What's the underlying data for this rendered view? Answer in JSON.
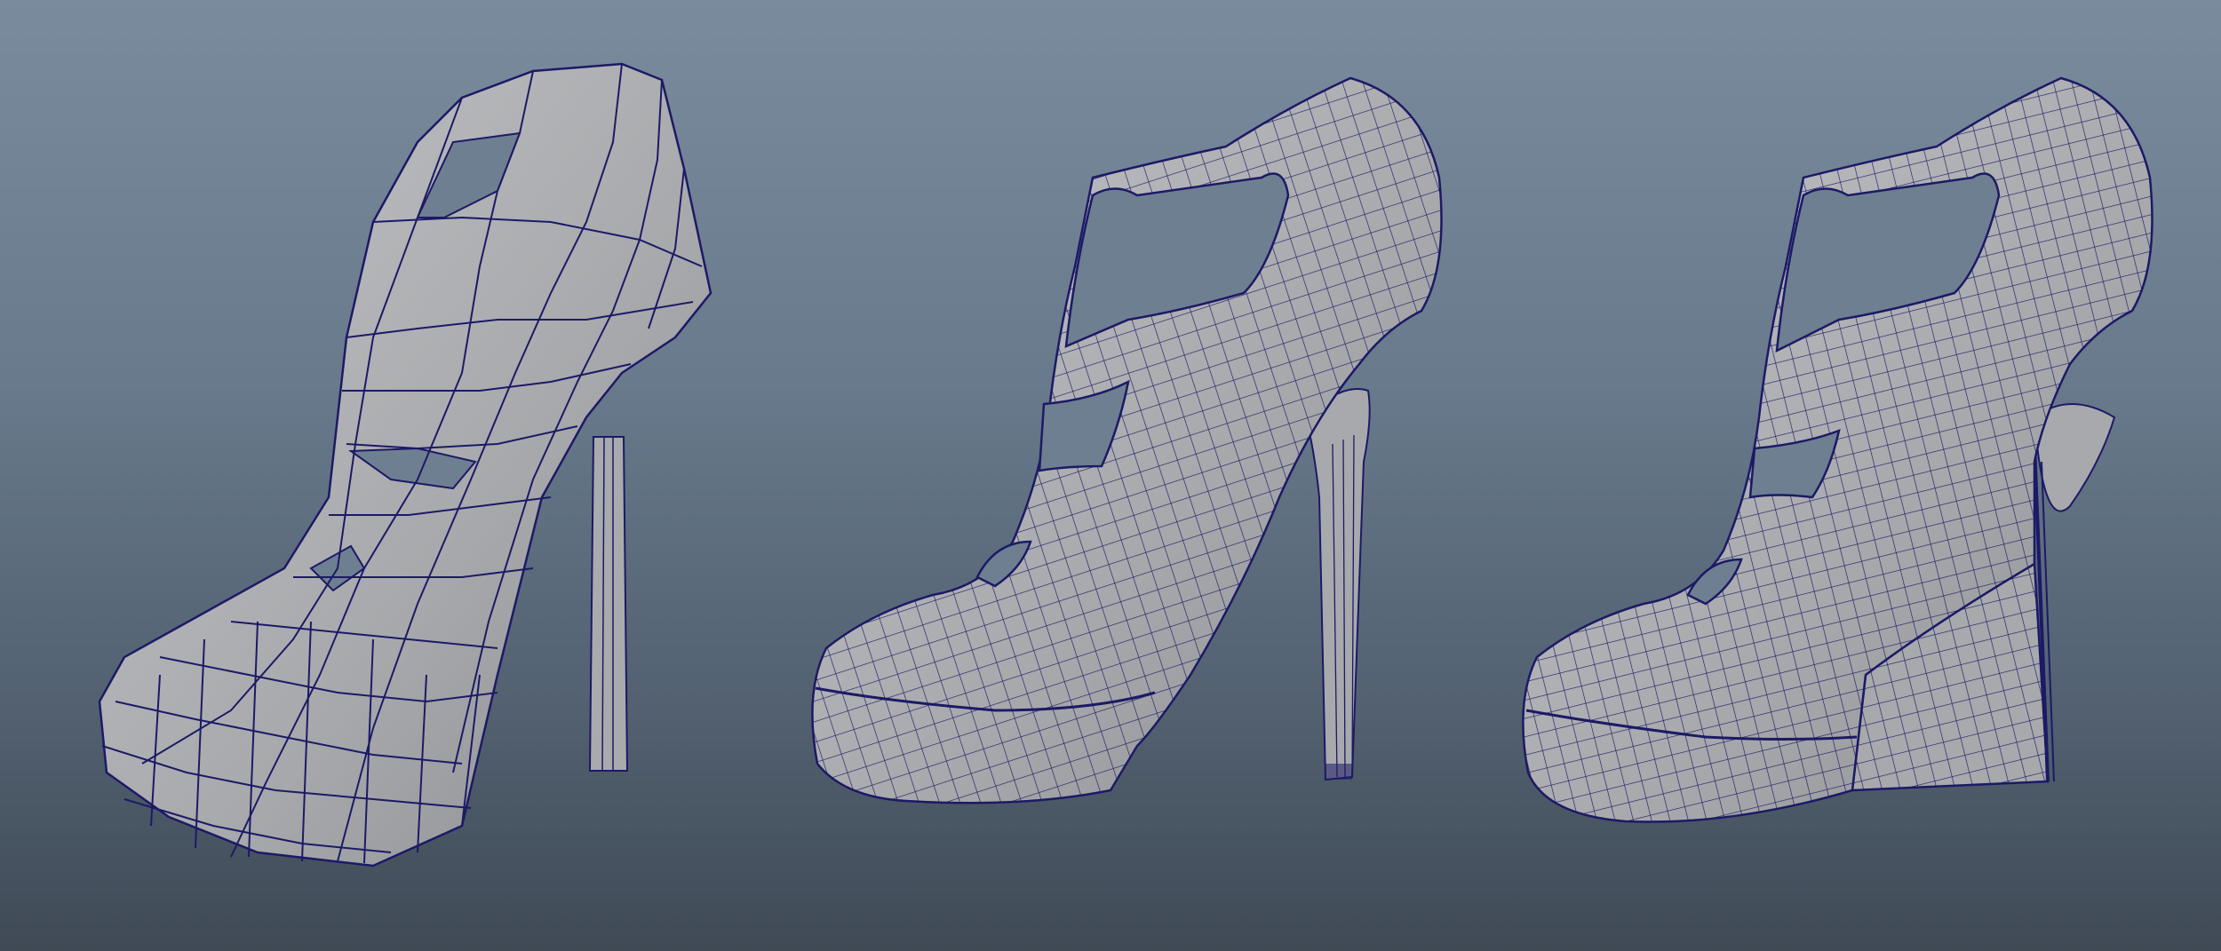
{
  "viewport": {
    "background_top": "#7a8b9e",
    "background_bottom": "#3f4a55"
  },
  "models": [
    {
      "id": "low-poly",
      "mesh_density": "low",
      "wire_color": "#1c1a66",
      "surface_color": "#a8a9ac"
    },
    {
      "id": "subdivided",
      "mesh_density": "high",
      "wire_color": "#1c1a66",
      "surface_color": "#a8a9ac"
    },
    {
      "id": "wedge",
      "mesh_density": "high",
      "wire_color": "#1c1a66",
      "surface_color": "#a8a9ac"
    }
  ]
}
